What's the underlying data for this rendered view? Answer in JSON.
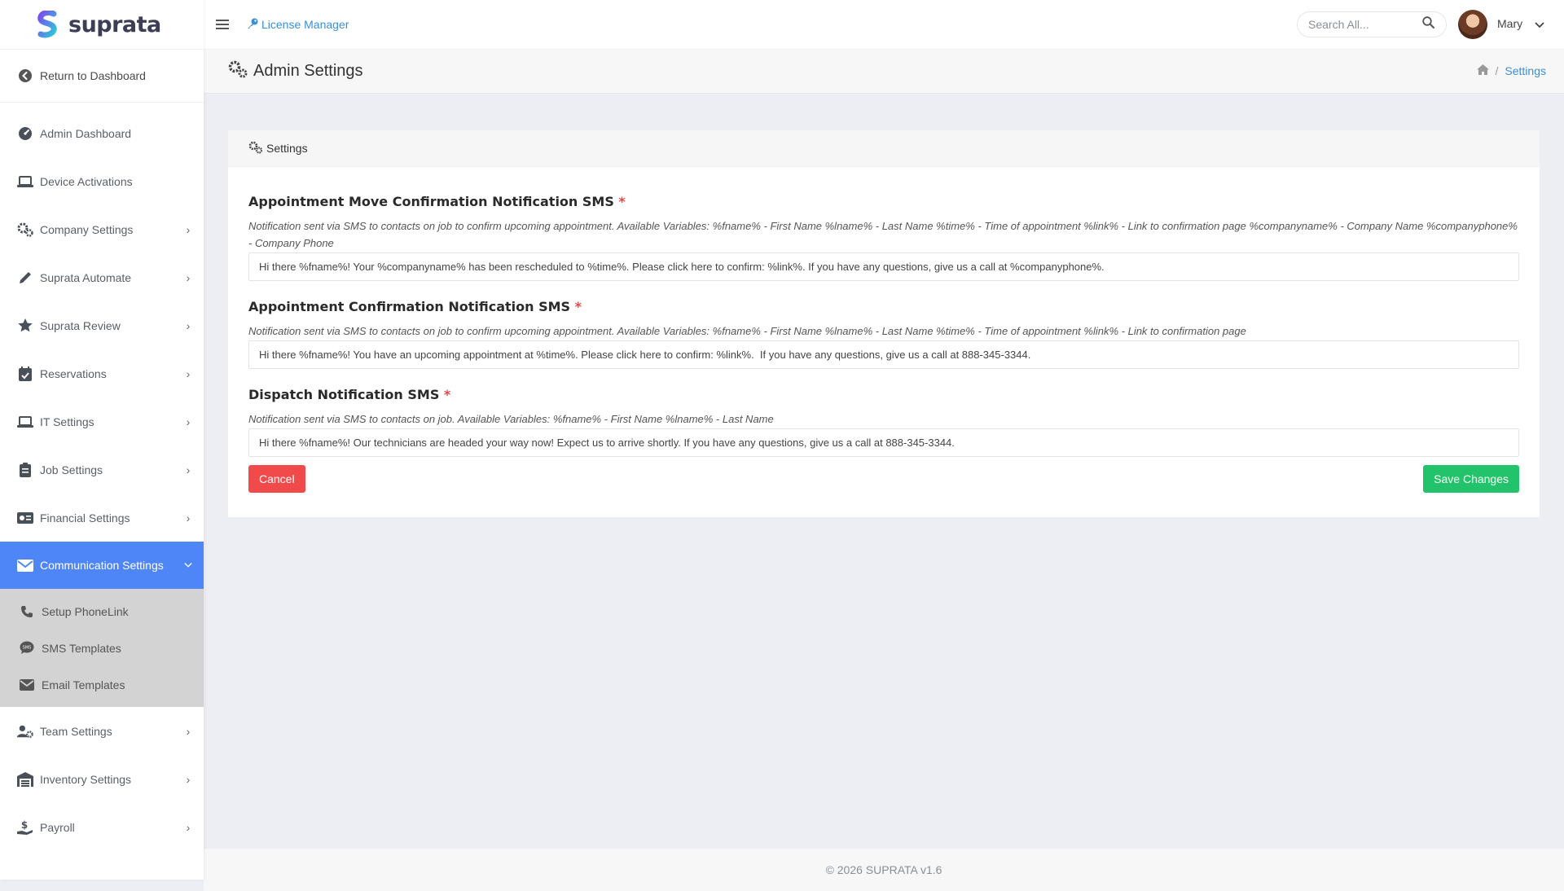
{
  "brand": {
    "name": "suprata"
  },
  "sidebar": {
    "return_label": "Return to Dashboard",
    "items": [
      {
        "label": "Admin Dashboard",
        "icon": "gauge-icon",
        "has_children": false
      },
      {
        "label": "Device Activations",
        "icon": "laptop-icon",
        "has_children": false
      },
      {
        "label": "Company Settings",
        "icon": "gears-icon",
        "has_children": true
      },
      {
        "label": "Suprata Automate",
        "icon": "pencil-icon",
        "has_children": true
      },
      {
        "label": "Suprata Review",
        "icon": "star-icon",
        "has_children": true
      },
      {
        "label": "Reservations",
        "icon": "calendar-check-icon",
        "has_children": true
      },
      {
        "label": "IT Settings",
        "icon": "laptop-icon",
        "has_children": true
      },
      {
        "label": "Job Settings",
        "icon": "clipboard-icon",
        "has_children": true
      },
      {
        "label": "Financial Settings",
        "icon": "money-card-icon",
        "has_children": true
      },
      {
        "label": "Communication Settings",
        "icon": "envelope-icon",
        "has_children": true,
        "active": true
      },
      {
        "label": "Team Settings",
        "icon": "users-gear-icon",
        "has_children": true
      },
      {
        "label": "Inventory Settings",
        "icon": "warehouse-icon",
        "has_children": true
      },
      {
        "label": "Payroll",
        "icon": "hand-dollar-icon",
        "has_children": true
      }
    ],
    "submenu": [
      {
        "label": "Setup PhoneLink",
        "icon": "phone-icon"
      },
      {
        "label": "SMS Templates",
        "icon": "sms-icon"
      },
      {
        "label": "Email Templates",
        "icon": "envelope-icon"
      }
    ],
    "active_color": "#4f86f7"
  },
  "topbar": {
    "license_label": "License Manager",
    "search_placeholder": "Search All...",
    "user_name": "Mary"
  },
  "page_header": {
    "title": "Admin Settings",
    "breadcrumb_current": "Settings"
  },
  "card": {
    "header": "Settings",
    "fields": [
      {
        "label": "Appointment Move Confirmation Notification SMS",
        "required_mark": "*",
        "help": "Notification sent via SMS to contacts on job to confirm upcoming appointment. Available Variables: %fname% - First Name %lname% - Last Name %time% - Time of appointment %link% - Link to confirmation page %companyname% - Company Name %companyphone% - Company Phone",
        "value": "Hi there %fname%! Your %companyname% has been rescheduled to %time%. Please click here to confirm: %link%. If you have any questions, give us a call at %companyphone%."
      },
      {
        "label": "Appointment Confirmation Notification SMS",
        "required_mark": "*",
        "help": "Notification sent via SMS to contacts on job to confirm upcoming appointment. Available Variables: %fname% - First Name %lname% - Last Name %time% - Time of appointment %link% - Link to confirmation page",
        "value": "Hi there %fname%! You have an upcoming appointment at %time%. Please click here to confirm: %link%.  If you have any questions, give us a call at 888-345-3344."
      },
      {
        "label": "Dispatch Notification SMS",
        "required_mark": "*",
        "help": "Notification sent via SMS to contacts on job. Available Variables: %fname% - First Name %lname% - Last Name",
        "value": "Hi there %fname%! Our technicians are headed your way now! Expect us to arrive shortly. If you have any questions, give us a call at 888-345-3344."
      }
    ],
    "cancel_label": "Cancel",
    "save_label": "Save Changes",
    "cancel_color": "#f14a4a",
    "save_color": "#22c36a"
  },
  "footer": {
    "text": "© 2026 SUPRATA v1.6"
  }
}
